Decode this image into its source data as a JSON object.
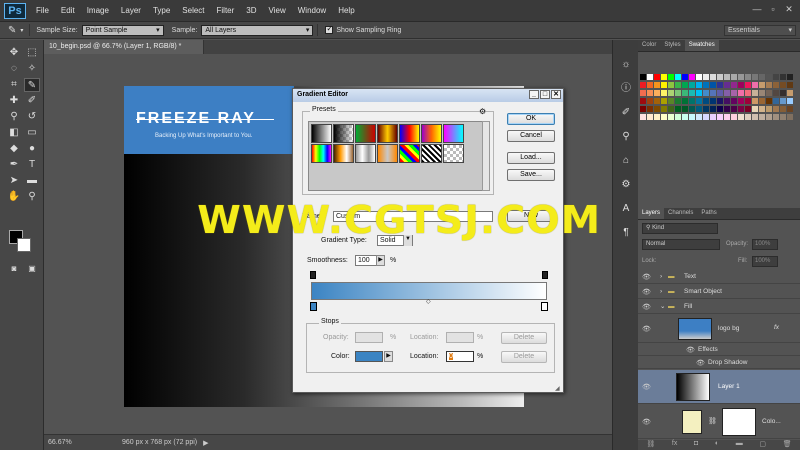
{
  "app": {
    "logo": "Ps"
  },
  "menu": [
    "File",
    "Edit",
    "Image",
    "Layer",
    "Type",
    "Select",
    "Filter",
    "3D",
    "View",
    "Window",
    "Help"
  ],
  "options": {
    "sample_size_label": "Sample Size:",
    "sample_size_value": "Point Sample",
    "sample_label": "Sample:",
    "sample_value": "All Layers",
    "show_ring_label": "Show Sampling Ring",
    "workspace": "Essentials"
  },
  "document": {
    "tab": "10_begin.psd @ 66.7% (Layer 1, RGB/8) *",
    "art_title": "FREEZE RAY",
    "art_subtitle": "Backing Up What's Important to You."
  },
  "status": {
    "zoom": "66.67%",
    "info": "960 px x 768 px (72 ppi)"
  },
  "panels": {
    "top_tabs": [
      "Color",
      "Styles",
      "Swatches"
    ],
    "layer_tabs": [
      "Layers",
      "Channels",
      "Paths"
    ],
    "kind_label": "Kind",
    "blend_mode": "Normal",
    "opacity_label": "Opacity:",
    "opacity_value": "100%",
    "lock_label": "Lock:",
    "fill_label": "Fill:",
    "fill_value": "100%",
    "layers": [
      {
        "name": "Text"
      },
      {
        "name": "Smart Object"
      },
      {
        "name": "Fill"
      },
      {
        "name": "logo bg"
      },
      {
        "name": "Effects"
      },
      {
        "name": "Drop Shadow"
      },
      {
        "name": "Layer 1"
      },
      {
        "name": "Colo..."
      }
    ],
    "fx": "fx"
  },
  "gradient_editor": {
    "title": "Gradient Editor",
    "presets_label": "Presets",
    "ok": "OK",
    "cancel": "Cancel",
    "load": "Load...",
    "save": "Save...",
    "name_label": "Name:",
    "name_value": "Custom",
    "new": "New",
    "gradient_type_label": "Gradient Type:",
    "gradient_type_value": "Solid",
    "smoothness_label": "Smoothness:",
    "smoothness_value": "100",
    "percent": "%",
    "stops_label": "Stops",
    "opacity_label": "Opacity:",
    "location_label": "Location:",
    "delete": "Delete",
    "color_label": "Color:",
    "color_location_value": "0",
    "gradient_start": "#3b84c3",
    "gradient_end": "#ffffff"
  },
  "watermark": "WWW.CGTSJ.COM"
}
